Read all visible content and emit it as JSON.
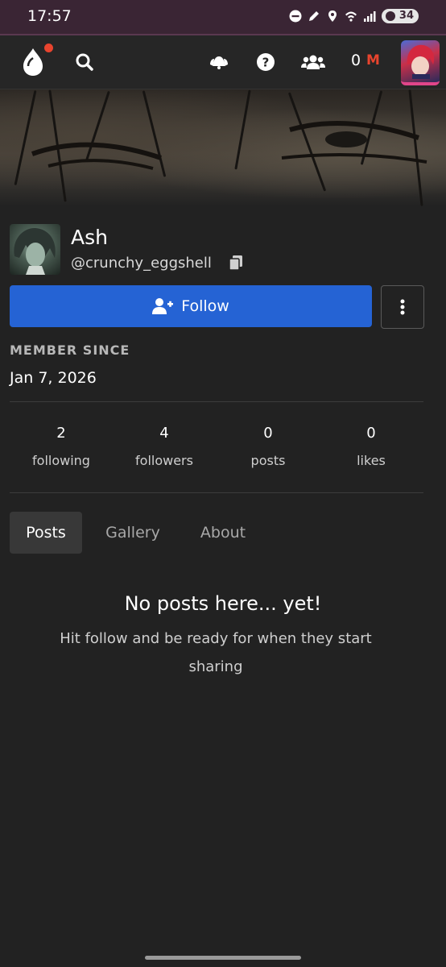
{
  "status_bar": {
    "time": "17:57",
    "battery": "34",
    "icons": [
      "do-not-disturb-icon",
      "pen-icon",
      "location-icon",
      "wifi-icon",
      "signal-icon",
      "battery-icon"
    ]
  },
  "nav": {
    "coin_count": "0",
    "coin_symbol": "M",
    "icons": [
      "logo-icon",
      "search-icon",
      "notifications-icon",
      "help-icon",
      "community-icon"
    ],
    "colors": {
      "accent": "#e8442e",
      "avatar_border": "#e0458a"
    }
  },
  "profile": {
    "name": "Ash",
    "handle": "@crunchy_eggshell",
    "follow_label": "Follow",
    "member_since_label": "MEMBER SINCE",
    "member_since_date": "Jan 7, 2026",
    "colors": {
      "follow_button": "#2563d4"
    }
  },
  "stats": [
    {
      "value": "2",
      "label": "following"
    },
    {
      "value": "4",
      "label": "followers"
    },
    {
      "value": "0",
      "label": "posts"
    },
    {
      "value": "0",
      "label": "likes"
    }
  ],
  "tabs": [
    {
      "label": "Posts",
      "active": true
    },
    {
      "label": "Gallery",
      "active": false
    },
    {
      "label": "About",
      "active": false
    }
  ],
  "empty_state": {
    "title": "No posts here... yet!",
    "subtitle": "Hit follow and be ready for when they start sharing"
  }
}
